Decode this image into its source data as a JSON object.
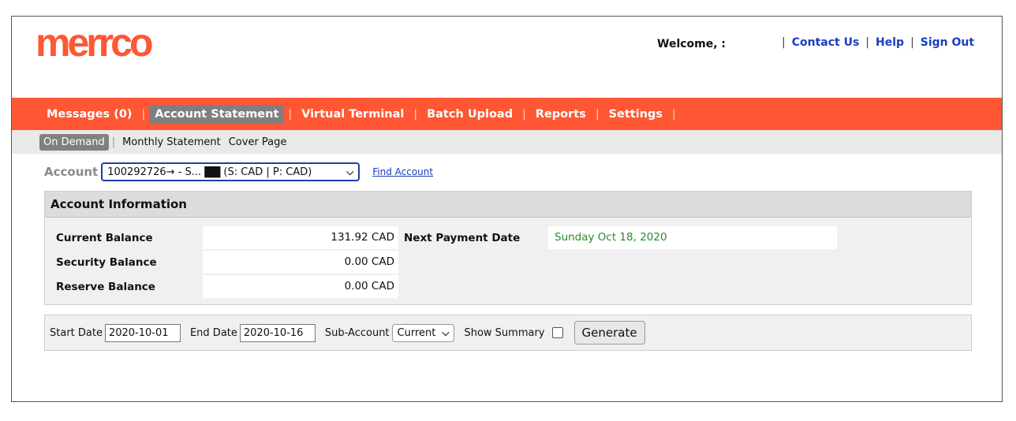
{
  "header": {
    "logo": "merrco",
    "welcome": "Welcome, :",
    "links": [
      "Contact Us",
      "Help",
      "Sign Out"
    ]
  },
  "mainnav": {
    "items": [
      {
        "label": "Messages (0)",
        "active": false
      },
      {
        "label": "Account Statement",
        "active": true
      },
      {
        "label": "Virtual Terminal",
        "active": false
      },
      {
        "label": "Batch Upload",
        "active": false
      },
      {
        "label": "Reports",
        "active": false
      },
      {
        "label": "Settings",
        "active": false
      }
    ]
  },
  "subnav": {
    "items": [
      {
        "label": "On Demand",
        "active": true
      },
      {
        "label": "Monthly Statement",
        "active": false
      },
      {
        "label": "Cover Page",
        "active": false
      }
    ]
  },
  "account": {
    "label": "Account",
    "selected": "100292726→ - S... ██ (S: CAD | P: CAD)",
    "find_link": "Find Account"
  },
  "info": {
    "title": "Account Information",
    "current_balance_label": "Current Balance",
    "current_balance": "131.92 CAD",
    "security_balance_label": "Security Balance",
    "security_balance": "0.00 CAD",
    "reserve_balance_label": "Reserve Balance",
    "reserve_balance": "0.00 CAD",
    "next_payment_label": "Next Payment Date",
    "next_payment": "Sunday Oct 18, 2020"
  },
  "filters": {
    "start_label": "Start Date",
    "start_value": "2020-10-01",
    "end_label": "End Date",
    "end_value": "2020-10-16",
    "subaccount_label": "Sub-Account",
    "subaccount_value": "Current",
    "summary_label": "Show Summary",
    "generate_label": "Generate"
  },
  "colors": {
    "brand": "#ff5733",
    "link": "#1a3cc4",
    "active_tab": "#7f7f7f",
    "positive": "#2a8a2a"
  }
}
